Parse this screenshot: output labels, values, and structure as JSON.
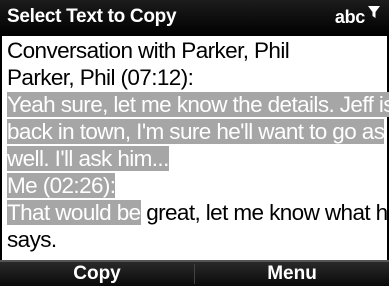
{
  "title_bar": {
    "title": "Select Text to Copy",
    "input_mode": "abc",
    "input_icon": "funnel-icon"
  },
  "content": {
    "line1": "Conversation with Parker, Phil",
    "line2": "Parker, Phil (07:12):",
    "line3": "Yeah sure, let me know the details. Jeff is",
    "line4": "back in town, I'm sure he'll want to go as",
    "line5": "well. I'll ask him...",
    "line6": "Me (02:26):",
    "line7_selected": "That would be",
    "line7_unselected": " great, let me know what he",
    "line8": "says."
  },
  "softkeys": {
    "left": "Copy",
    "right": "Menu"
  },
  "colors": {
    "selection": "#a6a6a6",
    "bar": "#000000"
  }
}
